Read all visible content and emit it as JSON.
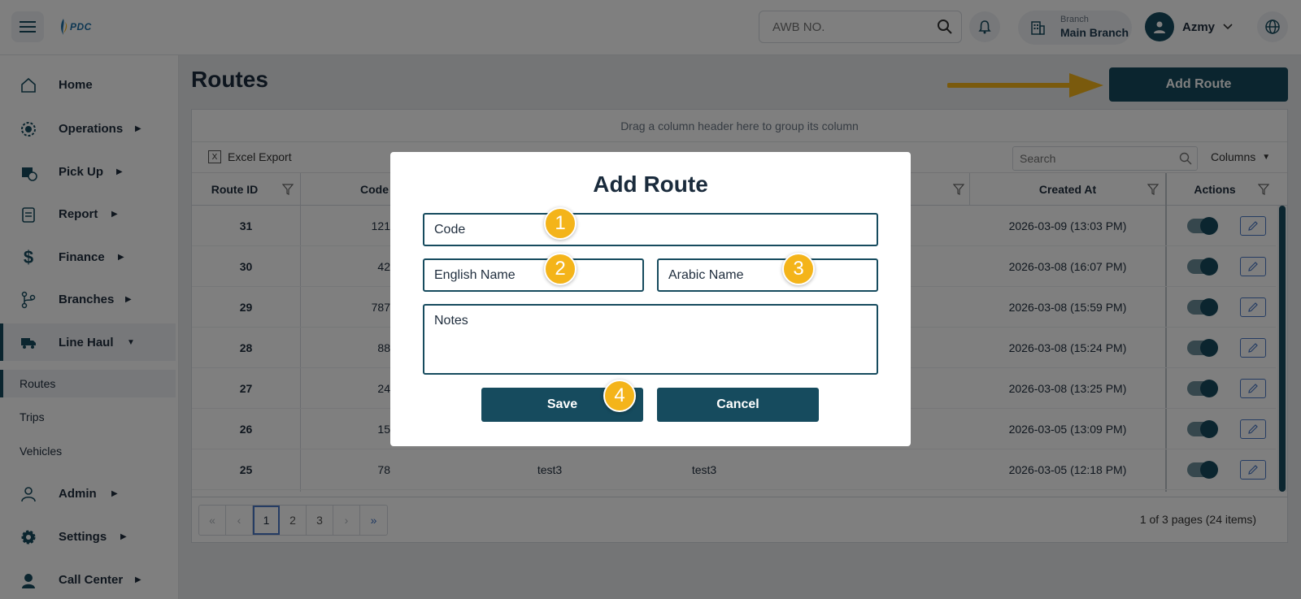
{
  "colors": {
    "primary": "#164b5e",
    "badge": "#f4b41a",
    "arrow": "#f4b41a"
  },
  "header": {
    "logo_text": "PDC",
    "awb_placeholder": "AWB NO.",
    "branch_label": "Branch",
    "branch_value": "Main Branch",
    "user_name": "Azmy"
  },
  "sidebar": {
    "items": [
      {
        "label": "Home",
        "icon": "home-icon"
      },
      {
        "label": "Operations",
        "icon": "operations-icon"
      },
      {
        "label": "Pick Up",
        "icon": "pickup-icon"
      },
      {
        "label": "Report",
        "icon": "report-icon"
      },
      {
        "label": "Finance",
        "icon": "dollar-icon"
      },
      {
        "label": "Branches",
        "icon": "branches-icon"
      },
      {
        "label": "Line Haul",
        "icon": "truck-icon"
      },
      {
        "label": "Admin",
        "icon": "user-icon"
      },
      {
        "label": "Settings",
        "icon": "gear-icon"
      },
      {
        "label": "Call Center",
        "icon": "agent-icon"
      }
    ],
    "subitems": [
      "Routes",
      "Trips",
      "Vehicles"
    ]
  },
  "main": {
    "title": "Routes",
    "add_button": "Add Route"
  },
  "grid": {
    "group_hint": "Drag a column header here to group its column",
    "excel_export": "Excel Export",
    "search_placeholder": "Search",
    "columns_label": "Columns",
    "headers": {
      "route_id": "Route ID",
      "code": "Code",
      "created_at": "Created At",
      "actions": "Actions"
    },
    "rows": [
      {
        "id": "31",
        "code": "121",
        "en": "",
        "ar": "",
        "created": "2026-03-09 (13:03 PM)"
      },
      {
        "id": "30",
        "code": "42",
        "en": "",
        "ar": "",
        "created": "2026-03-08 (16:07 PM)"
      },
      {
        "id": "29",
        "code": "787",
        "en": "",
        "ar": "",
        "created": "2026-03-08 (15:59 PM)"
      },
      {
        "id": "28",
        "code": "88",
        "en": "",
        "ar": "",
        "created": "2026-03-08 (15:24 PM)"
      },
      {
        "id": "27",
        "code": "24",
        "en": "",
        "ar": "",
        "created": "2026-03-08 (13:25 PM)"
      },
      {
        "id": "26",
        "code": "15",
        "en": "",
        "ar": "",
        "created": "2026-03-05 (13:09 PM)"
      },
      {
        "id": "25",
        "code": "78",
        "en": "test3",
        "ar": "test3",
        "created": "2026-03-05 (12:18 PM)"
      }
    ],
    "pages": [
      "1",
      "2",
      "3"
    ],
    "page_info": "1 of 3 pages (24 items)"
  },
  "modal": {
    "title": "Add Route",
    "code_placeholder": "Code",
    "english_placeholder": "English Name",
    "arabic_placeholder": "Arabic Name",
    "notes_placeholder": "Notes",
    "save": "Save",
    "cancel": "Cancel",
    "badges": [
      "1",
      "2",
      "3",
      "4"
    ]
  }
}
